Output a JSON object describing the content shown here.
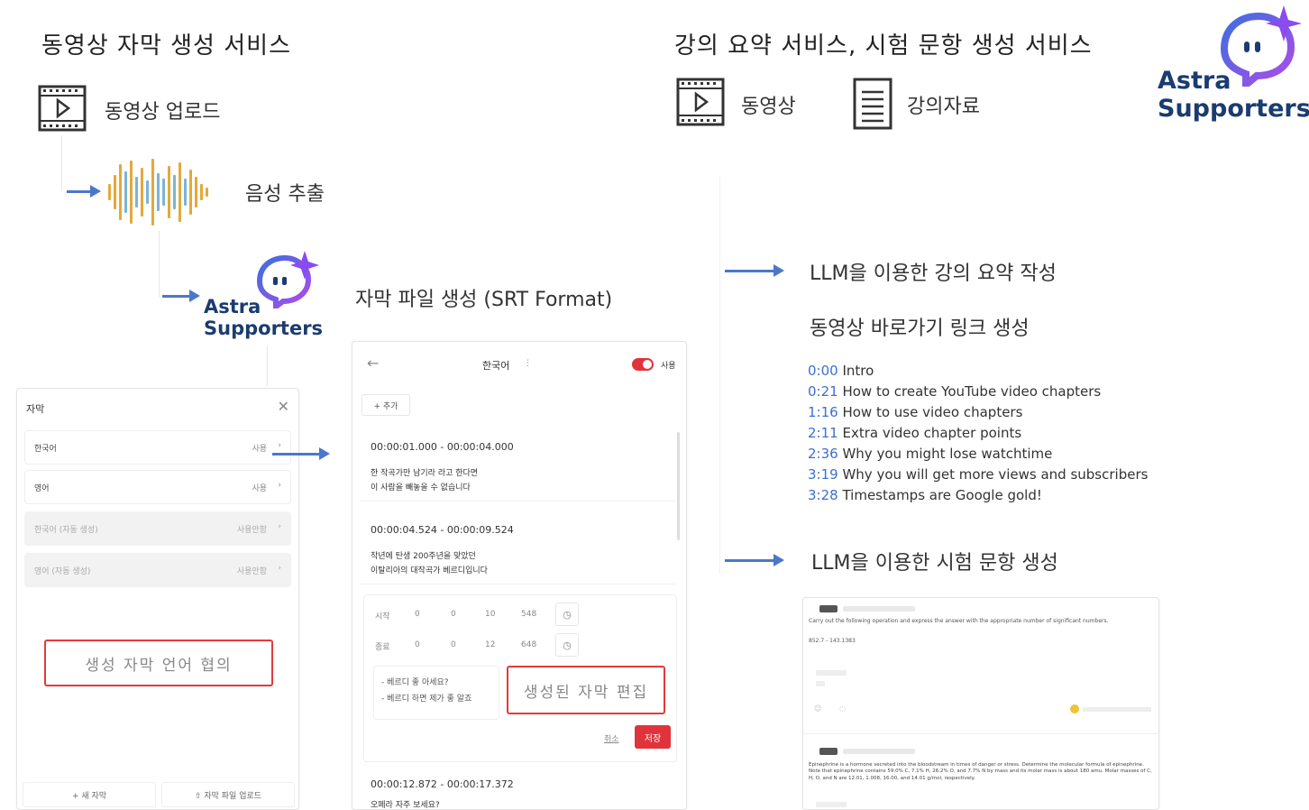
{
  "left_section": {
    "title": "동영상 자막 생성 서비스",
    "upload_label": "동영상 업로드",
    "extract_label": "음성 추출",
    "srt_label": "자막 파일 생성 (SRT Format)"
  },
  "right_section": {
    "title": "강의 요약 서비스, 시험 문항 생성 서비스",
    "video_label": "동영상",
    "material_label": "강의자료",
    "summary_label": "LLM을 이용한 강의 요약 작성",
    "chapter_label": "동영상 바로가기 링크 생성",
    "question_label": "LLM을 이용한 시험 문항 생성"
  },
  "brand": {
    "line1": "Astra",
    "line2": "Supporters"
  },
  "subtitle_panel": {
    "title": "자막",
    "rows": [
      {
        "lang": "한국어",
        "status": "사용",
        "disabled": false
      },
      {
        "lang": "영어",
        "status": "사용",
        "disabled": false
      },
      {
        "lang": "한국어 (자동 생성)",
        "status": "사용안함",
        "disabled": true
      },
      {
        "lang": "영어 (자동 생성)",
        "status": "사용안함",
        "disabled": true
      }
    ],
    "highlight": "생성 자막 언어 협의",
    "new_button": "+ 새 자막",
    "upload_button": "⇧ 자막 파일 업로드"
  },
  "editor_panel": {
    "language": "한국어",
    "toggle_label": "사용",
    "add_button": "+ 추가",
    "cues": [
      {
        "time": "00:00:01.000 - 00:00:04.000",
        "line1": "한 작곡가만 남기라 라고 한다면",
        "line2": "이 사람을 빼놓을 수 없습니다"
      },
      {
        "time": "00:00:04.524 - 00:00:09.524",
        "line1": "작년에 탄생 200주년을 맞았던",
        "line2": "이탈리아의 대작곡가 베르디입니다"
      },
      {
        "time": "00:00:12.872 - 00:00:17.372",
        "line1": "오페라 자주 보세요?",
        "line2": ""
      }
    ],
    "start_label": "시작",
    "end_label": "종료",
    "start_time": [
      "0",
      "0",
      "10",
      "548"
    ],
    "end_time": [
      "0",
      "0",
      "12",
      "648"
    ],
    "edit_text1": "- 베르디 좋 아세요?",
    "edit_text2": "- 베르디 하면 제가 좋 알죠",
    "highlight": "생성된 자막 편집",
    "cancel": "취소",
    "save": "저장"
  },
  "chapters": [
    {
      "ts": "0:00",
      "text": "Intro"
    },
    {
      "ts": "0:21",
      "text": "How to create YouTube video chapters"
    },
    {
      "ts": "1:16",
      "text": "How to use video chapters"
    },
    {
      "ts": "2:11",
      "text": "Extra video chapter points"
    },
    {
      "ts": "2:36",
      "text": "Why you might lose watchtime"
    },
    {
      "ts": "3:19",
      "text": "Why you will get more views and subscribers"
    },
    {
      "ts": "3:28",
      "text": "Timestamps are Google gold!"
    }
  ],
  "question_panel": {
    "q1_prompt": "Carry out the following operation and express the answer with the appropriate number of significant numbers.",
    "q1_expr": "852.7 - 143.1383",
    "q2_prompt": "Epinephrine is a hormone secreted into the bloodstream in times of danger or stress. Determine the molecular formula of epinephrine. Note that epinephrine contains 59.0% C, 7.1% H, 26.2% O, and 7.7% N by mass and its molar mass is about 180 amu. Molar masses of C, H, O, and N are 12.01, 1.008, 16.00, and 14.01 g/mol, respectively."
  },
  "colors": {
    "accent_arrow": "#4a78c9",
    "highlight_border": "#e23b3b",
    "toggle": "#e0333b",
    "save": "#e0333b",
    "link": "#3b6fd1",
    "logo_purple": "#7a4ff0"
  }
}
